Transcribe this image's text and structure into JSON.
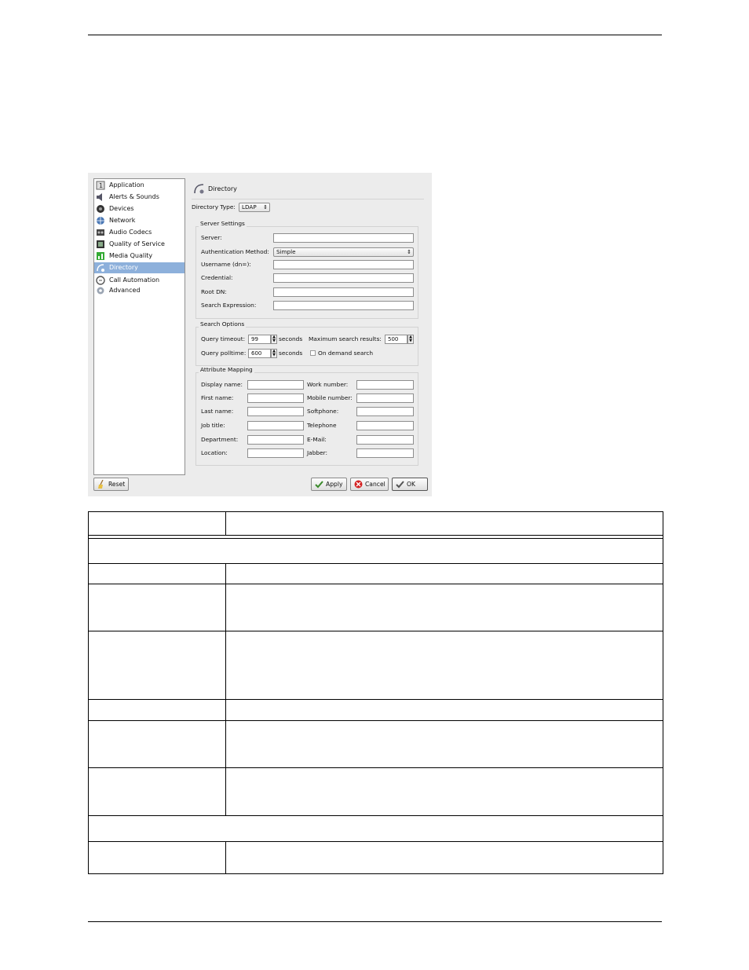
{
  "dialog": {
    "nav_items": [
      {
        "label": "Application",
        "icon": "application-icon"
      },
      {
        "label": "Alerts & Sounds",
        "icon": "speaker-icon"
      },
      {
        "label": "Devices",
        "icon": "headset-icon"
      },
      {
        "label": "Network",
        "icon": "network-icon"
      },
      {
        "label": "Audio Codecs",
        "icon": "codec-icon"
      },
      {
        "label": "Quality of Service",
        "icon": "qos-icon"
      },
      {
        "label": "Media Quality",
        "icon": "media-quality-icon"
      },
      {
        "label": "Directory",
        "icon": "directory-icon",
        "selected": true
      },
      {
        "label": "Call Automation",
        "icon": "call-automation-icon"
      },
      {
        "label": "Advanced",
        "icon": "gear-icon"
      }
    ],
    "panel_title": "Directory",
    "directory_type_label": "Directory Type:",
    "directory_type_value": "LDAP",
    "server_settings": {
      "legend": "Server Settings",
      "server_label": "Server:",
      "auth_label": "Authentication Method:",
      "auth_value": "Simple",
      "username_label": "Username (dn=):",
      "credential_label": "Credential:",
      "rootdn_label": "Root DN:",
      "search_expr_label": "Search Expression:"
    },
    "search_options": {
      "legend": "Search Options",
      "query_timeout_label": "Query timeout:",
      "query_timeout_value": "99",
      "seconds1": "seconds",
      "max_results_label": "Maximum search results:",
      "max_results_value": "500",
      "query_polltime_label": "Query polltime:",
      "query_polltime_value": "600",
      "seconds2": "seconds",
      "on_demand_label": "On demand search"
    },
    "attribute_mapping": {
      "legend": "Attribute Mapping",
      "left_labels": [
        "Display name:",
        "First name:",
        "Last name:",
        "Job title:",
        "Department:",
        "Location:"
      ],
      "right_labels": [
        "Work number:",
        "Mobile number:",
        "Softphone:",
        "Telephone",
        "E-Mail:",
        "Jabber:"
      ]
    },
    "buttons": {
      "reset": "Reset",
      "apply": "Apply",
      "cancel": "Cancel",
      "ok": "OK"
    }
  }
}
